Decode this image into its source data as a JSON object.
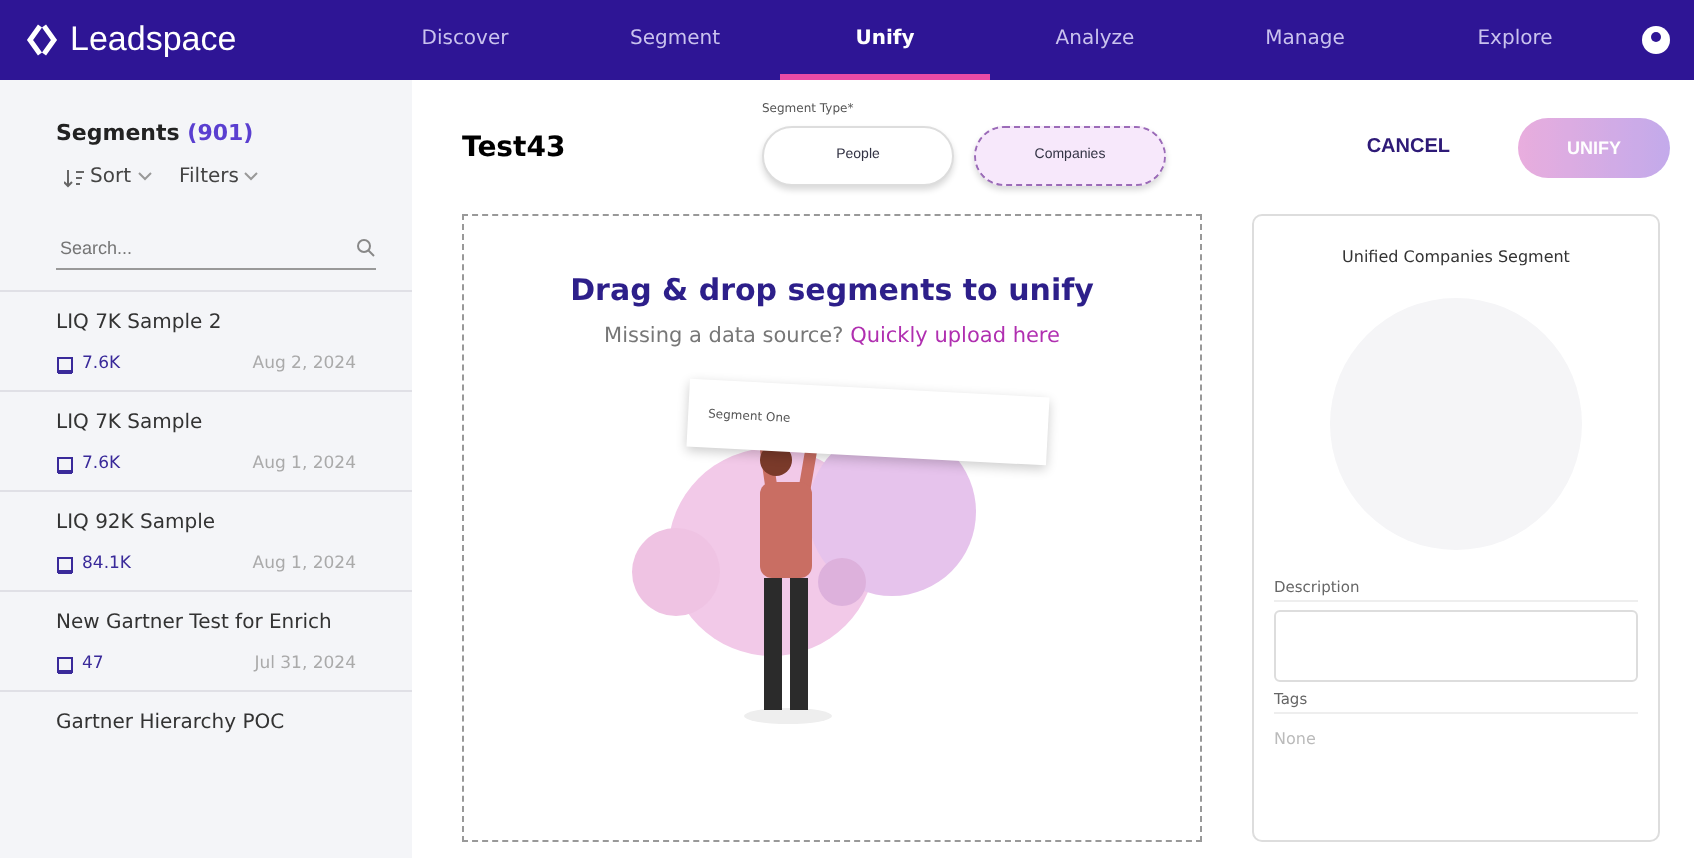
{
  "header": {
    "logo": "Leadspace",
    "nav": [
      {
        "label": "Discover",
        "selected": false
      },
      {
        "label": "Segment",
        "selected": false
      },
      {
        "label": "Unify",
        "selected": true
      },
      {
        "label": "Analyze",
        "selected": false
      },
      {
        "label": "Manage",
        "selected": false
      },
      {
        "label": "Explore",
        "selected": false
      }
    ]
  },
  "sidebar": {
    "title": "Segments",
    "count": "(901)",
    "sort": "Sort",
    "filters": "Filters",
    "search": {
      "placeholder": "Search..."
    },
    "items": [
      {
        "name": "LIQ 7K Sample 2",
        "size": "7.6K",
        "date": "Aug 2, 2024"
      },
      {
        "name": "LIQ 7K Sample",
        "size": "7.6K",
        "date": "Aug 1, 2024"
      },
      {
        "name": "LIQ 92K Sample",
        "size": "84.1K",
        "date": "Aug 1, 2024"
      },
      {
        "name": "New Gartner Test for Enrich",
        "size": "47",
        "date": "Jul 31, 2024"
      },
      {
        "name": "Gartner Hierarchy POC"
      }
    ]
  },
  "main": {
    "title": "Test43",
    "segment_type": {
      "label": "Segment Type*",
      "options": [
        {
          "label": "People",
          "selected": false
        },
        {
          "label": "Companies",
          "selected": true
        }
      ]
    },
    "dropzone": {
      "heading": "Drag & drop segments to unify",
      "prompt": "Missing a data source?",
      "link": "Quickly upload here",
      "card_label": "Segment One"
    }
  },
  "actions": {
    "cancel": "CANCEL",
    "unify": "UNIFY",
    "unify_disabled": true
  },
  "panel": {
    "title": "Unified Companies Segment",
    "description_label": "Description",
    "tags_label": "Tags",
    "tags_value": "None"
  }
}
